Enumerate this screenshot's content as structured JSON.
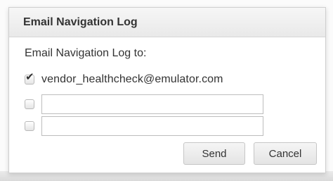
{
  "dialog": {
    "title": "Email Navigation Log",
    "prompt": "Email Navigation Log to:",
    "recipients": [
      {
        "checked": true,
        "label": "vendor_healthcheck@emulator.com"
      },
      {
        "checked": false,
        "value": "",
        "placeholder": ""
      },
      {
        "checked": false,
        "value": "",
        "placeholder": ""
      }
    ],
    "buttons": {
      "send_label": "Send",
      "cancel_label": "Cancel"
    }
  },
  "icons": {
    "checkmark": "checkmark-icon"
  },
  "colors": {
    "title_bar": "#eeeeee",
    "text": "#333333",
    "border": "#c6c6c6"
  }
}
